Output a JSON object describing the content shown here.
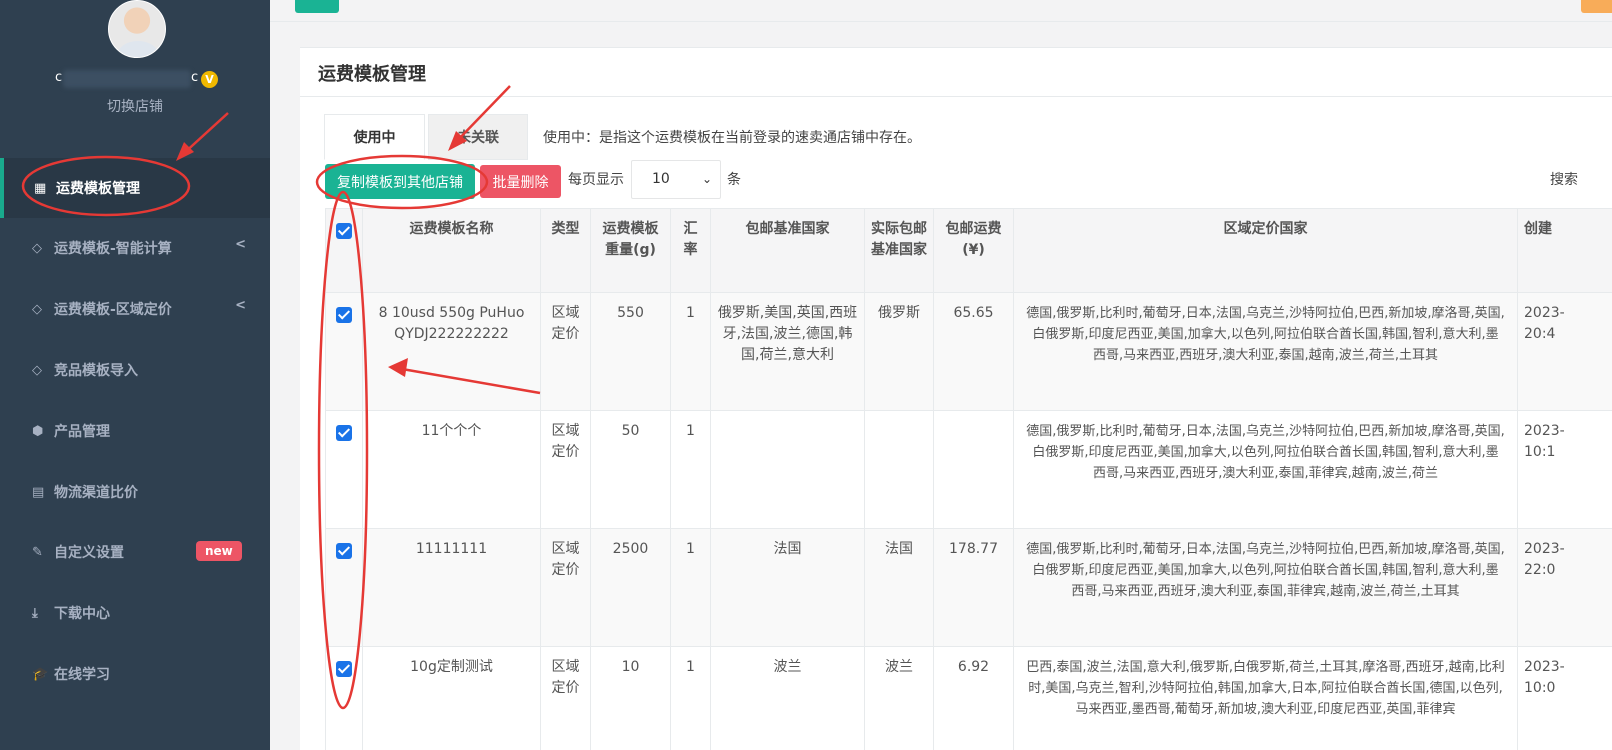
{
  "sidebar": {
    "user_name_prefix": "c",
    "user_name_suffix": "c",
    "vip_badge": "V",
    "switch_shop": "切换店铺",
    "items": [
      {
        "label": "运费模板管理",
        "icon": "table-icon",
        "active": true
      },
      {
        "label": "运费模板-智能计算",
        "icon": "diamond-icon",
        "arrow": "<"
      },
      {
        "label": "运费模板-区域定价",
        "icon": "diamond-icon",
        "arrow": "<"
      },
      {
        "label": "竞品模板导入",
        "icon": "diamond-icon"
      },
      {
        "label": "产品管理",
        "icon": "cube-icon"
      },
      {
        "label": "物流渠道比价",
        "icon": "calculator-icon"
      },
      {
        "label": "自定义设置",
        "icon": "wrench-icon",
        "badge": "new"
      },
      {
        "label": "下载中心",
        "icon": "download-icon"
      },
      {
        "label": "在线学习",
        "icon": "graduation-cap-icon"
      }
    ]
  },
  "panel": {
    "title": "运费模板管理",
    "tabs": [
      {
        "label": "使用中",
        "active": true
      },
      {
        "label": "未关联",
        "active": false
      }
    ],
    "tab_note": "使用中：是指这个运费模板在当前登录的速卖通店铺中存在。",
    "copy_button": "复制模板到其他店铺",
    "delete_button": "批量删除",
    "per_page_label": "每页显示",
    "per_page_value": "10",
    "per_page_unit": "条",
    "search_label": "搜索"
  },
  "table": {
    "headers": [
      "运费模板名称",
      "类型",
      "运费模板重量(g)",
      "汇率",
      "包邮基准国家",
      "实际包邮基准国家",
      "包邮运费(¥)",
      "区域定价国家",
      "创建"
    ],
    "rows": [
      {
        "checked": true,
        "name": "8 10usd 550g PuHuo QYDJ222222222",
        "type": "区域定价",
        "weight": "550",
        "rate": "1",
        "free_base": "俄罗斯,美国,英国,西班牙,法国,波兰,德国,韩国,荷兰,意大利",
        "actual_base": "俄罗斯",
        "free_cost": "65.65",
        "regions": "德国,俄罗斯,比利时,葡萄牙,日本,法国,乌克兰,沙特阿拉伯,巴西,新加坡,摩洛哥,英国,白俄罗斯,印度尼西亚,美国,加拿大,以色列,阿拉伯联合酋长国,韩国,智利,意大利,墨西哥,马来西亚,西班牙,澳大利亚,泰国,越南,波兰,荷兰,土耳其",
        "created": "2023-\n20:4"
      },
      {
        "checked": true,
        "name": "11个个个",
        "type": "区域定价",
        "weight": "50",
        "rate": "1",
        "free_base": "",
        "actual_base": "",
        "free_cost": "",
        "regions": "德国,俄罗斯,比利时,葡萄牙,日本,法国,乌克兰,沙特阿拉伯,巴西,新加坡,摩洛哥,英国,白俄罗斯,印度尼西亚,美国,加拿大,以色列,阿拉伯联合酋长国,韩国,智利,意大利,墨西哥,马来西亚,西班牙,澳大利亚,泰国,菲律宾,越南,波兰,荷兰",
        "created": "2023-\n10:1"
      },
      {
        "checked": true,
        "name": "11111111",
        "type": "区域定价",
        "weight": "2500",
        "rate": "1",
        "free_base": "法国",
        "actual_base": "法国",
        "free_cost": "178.77",
        "regions": "德国,俄罗斯,比利时,葡萄牙,日本,法国,乌克兰,沙特阿拉伯,巴西,新加坡,摩洛哥,英国,白俄罗斯,印度尼西亚,美国,加拿大,以色列,阿拉伯联合酋长国,韩国,智利,意大利,墨西哥,马来西亚,西班牙,澳大利亚,泰国,菲律宾,越南,波兰,荷兰,土耳其",
        "created": "2023-\n22:0"
      },
      {
        "checked": true,
        "name": "10g定制测试",
        "type": "区域定价",
        "weight": "10",
        "rate": "1",
        "free_base": "波兰",
        "actual_base": "波兰",
        "free_cost": "6.92",
        "regions": "巴西,泰国,波兰,法国,意大利,俄罗斯,白俄罗斯,荷兰,土耳其,摩洛哥,西班牙,越南,比利时,美国,乌克兰,智利,沙特阿拉伯,韩国,加拿大,日本,阿拉伯联合酋长国,德国,以色列,马来西亚,墨西哥,葡萄牙,新加坡,澳大利亚,印度尼西亚,英国,菲律宾",
        "created": "2023-\n10:0"
      }
    ]
  },
  "colors": {
    "sidebar_bg": "#2f4050",
    "accent_green": "#1ab394",
    "danger_red": "#ed5565",
    "annotation_red": "#e53935"
  }
}
